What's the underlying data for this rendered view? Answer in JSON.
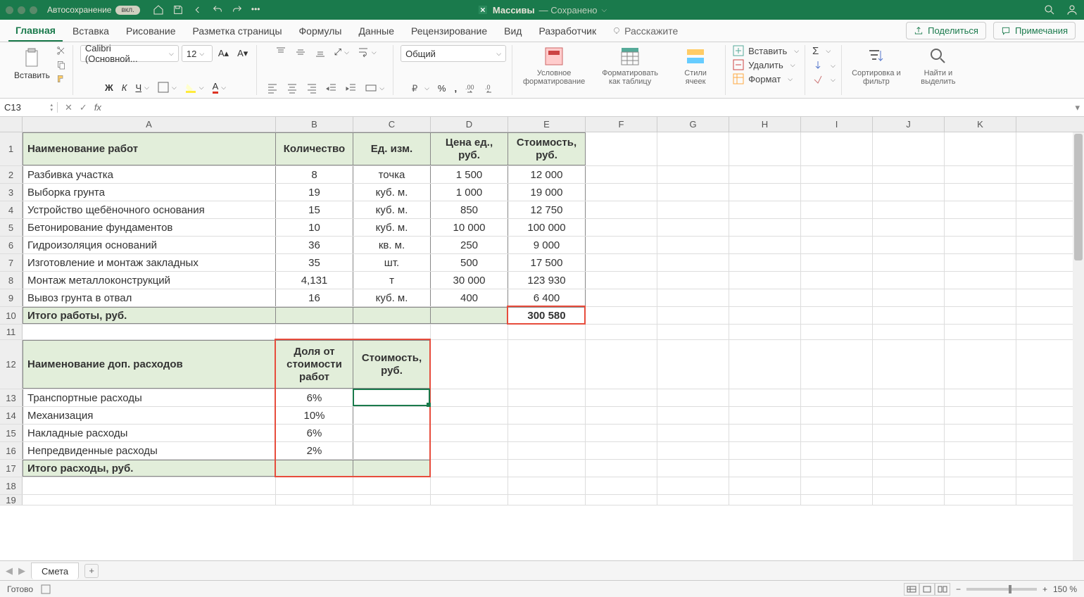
{
  "titlebar": {
    "autosave_label": "Автосохранение",
    "autosave_state": "вкл.",
    "doc_name": "Массивы",
    "saved": "— Сохранено"
  },
  "tabs": {
    "home": "Главная",
    "insert": "Вставка",
    "draw": "Рисование",
    "layout": "Разметка страницы",
    "formulas": "Формулы",
    "data": "Данные",
    "review": "Рецензирование",
    "view": "Вид",
    "developer": "Разработчик",
    "tell": "Расскажите",
    "share": "Поделиться",
    "comments": "Примечания"
  },
  "ribbon": {
    "paste": "Вставить",
    "font_name": "Calibri (Основной...",
    "font_size": "12",
    "number_format": "Общий",
    "cond_format": "Условное форматирование",
    "format_table": "Форматировать как таблицу",
    "cell_styles": "Стили ячеек",
    "insert": "Вставить",
    "delete": "Удалить",
    "format": "Формат",
    "sort": "Сортировка и фильтр",
    "find": "Найти и выделить"
  },
  "namebox": "C13",
  "cols": {
    "A": 360,
    "B": 110,
    "C": 110,
    "D": 110,
    "E": 110,
    "F": 102,
    "G": 102,
    "H": 102,
    "I": 102,
    "J": 102,
    "K": 102
  },
  "headers1": {
    "A": "Наименование работ",
    "B": "Количество",
    "C": "Ед. изм.",
    "D": "Цена ед., руб.",
    "E": "Стоимость, руб."
  },
  "rows1": [
    {
      "a": "Разбивка участка",
      "b": "8",
      "c": "точка",
      "d": "1 500",
      "e": "12 000"
    },
    {
      "a": "Выборка грунта",
      "b": "19",
      "c": "куб. м.",
      "d": "1 000",
      "e": "19 000"
    },
    {
      "a": "Устройство щебёночного основания",
      "b": "15",
      "c": "куб. м.",
      "d": "850",
      "e": "12 750"
    },
    {
      "a": "Бетонирование фундаментов",
      "b": "10",
      "c": "куб. м.",
      "d": "10 000",
      "e": "100 000"
    },
    {
      "a": "Гидроизоляция оснований",
      "b": "36",
      "c": "кв. м.",
      "d": "250",
      "e": "9 000"
    },
    {
      "a": "Изготовление и монтаж закладных",
      "b": "35",
      "c": "шт.",
      "d": "500",
      "e": "17 500"
    },
    {
      "a": "Монтаж металлоконструкций",
      "b": "4,131",
      "c": "т",
      "d": "30 000",
      "e": "123 930"
    },
    {
      "a": "Вывоз грунта в отвал",
      "b": "16",
      "c": "куб. м.",
      "d": "400",
      "e": "6 400"
    }
  ],
  "total1": {
    "label": "Итого работы, руб.",
    "value": "300 580"
  },
  "headers2": {
    "A": "Наименование доп. расходов",
    "B": "Доля от стоимости работ",
    "C": "Стоимость, руб."
  },
  "rows2": [
    {
      "a": "Транспортные расходы",
      "b": "6%"
    },
    {
      "a": "Механизация",
      "b": "10%"
    },
    {
      "a": "Накладные расходы",
      "b": "6%"
    },
    {
      "a": "Непредвиденные расходы",
      "b": "2%"
    }
  ],
  "total2": {
    "label": "Итого расходы, руб."
  },
  "sheet_tab": "Смета",
  "status": {
    "ready": "Готово",
    "zoom": "150 %"
  }
}
